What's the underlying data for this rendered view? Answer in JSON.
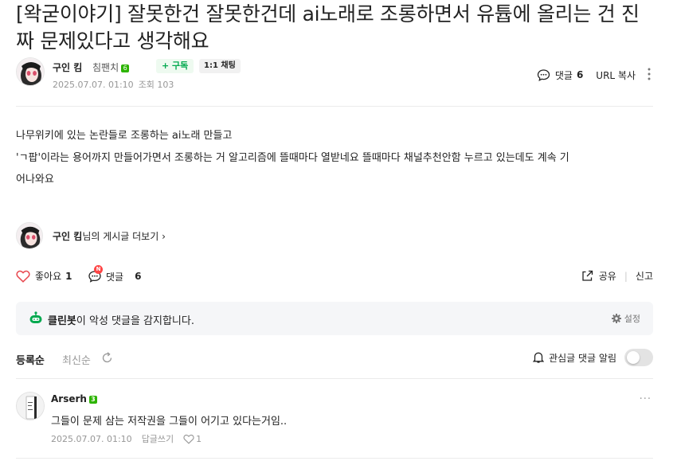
{
  "post": {
    "title": "[왁굳이야기] 잘못한건 잘못한건데 ai노래로 조롱하면서 유튭에 올리는 건 진짜 문제있다고 생각해요",
    "author": "구인 킴",
    "level": "침팬치",
    "level_badge": "6",
    "subscribe_label": "+ 구독",
    "chat_label": "1:1 채팅",
    "date": "2025.07.07. 01:10",
    "views_label": "조회 103",
    "comment_label": "댓글",
    "comment_count": "6",
    "url_copy": "URL 복사",
    "body_lines": [
      "나무위키에 있는 논란들로 조롱하는 ai노래 만들고",
      "'ㄱ팝'이라는 용어까지 만들어가면서 조롱하는 거 알고리즘에 뜰때마다 열받네요 뜰때마다 채널추천안함 누르고 있는데도 계속 기",
      "어나와요"
    ],
    "more_posts_author": "구인 킴",
    "more_posts_suffix": "님의 게시글 더보기 ›"
  },
  "reactions": {
    "like_label": "좋아요",
    "like_count": "1",
    "comment_label": "댓글",
    "comment_count": "6",
    "new_badge": "N",
    "share_label": "공유",
    "separator": "|",
    "report_label": "신고"
  },
  "bot": {
    "name": "클린봇",
    "text": "이 악성 댓글을 감지합니다.",
    "settings_label": "설정"
  },
  "sort": {
    "registered": "등록순",
    "newest": "최신순",
    "alarm_label": "관심글 댓글 알림"
  },
  "comment": {
    "author": "Arserh",
    "badge": "3",
    "text": "그들이 문제 삼는 저작권을 그들이 어기고 있다는거임..",
    "date": "2025.07.07. 01:10",
    "reply_label": "답글쓰기",
    "like_count": "1",
    "more": "···"
  },
  "colors": {
    "accent_green": "#03a94f",
    "new_red": "#ff4545",
    "level_green": "#2db400"
  }
}
